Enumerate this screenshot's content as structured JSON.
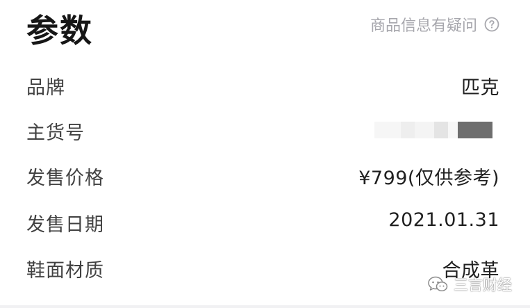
{
  "header": {
    "title": "参数",
    "question_link": "商品信息有疑问"
  },
  "params": [
    {
      "label": "品牌",
      "value": "匹克"
    },
    {
      "label": "主货号",
      "value": ""
    },
    {
      "label": "发售价格",
      "value": "¥799(仅供参考)"
    },
    {
      "label": "发售日期",
      "value": "2021.01.31"
    },
    {
      "label": "鞋面材质",
      "value": "合成革"
    }
  ],
  "watermark": {
    "text": "三言财经"
  },
  "colors": {
    "title": "#161616",
    "label": "#414141",
    "value": "#202020",
    "muted": "#a7a7ad"
  },
  "icons": {
    "question": "question-circle-icon",
    "watermark": "wechat-icon"
  }
}
